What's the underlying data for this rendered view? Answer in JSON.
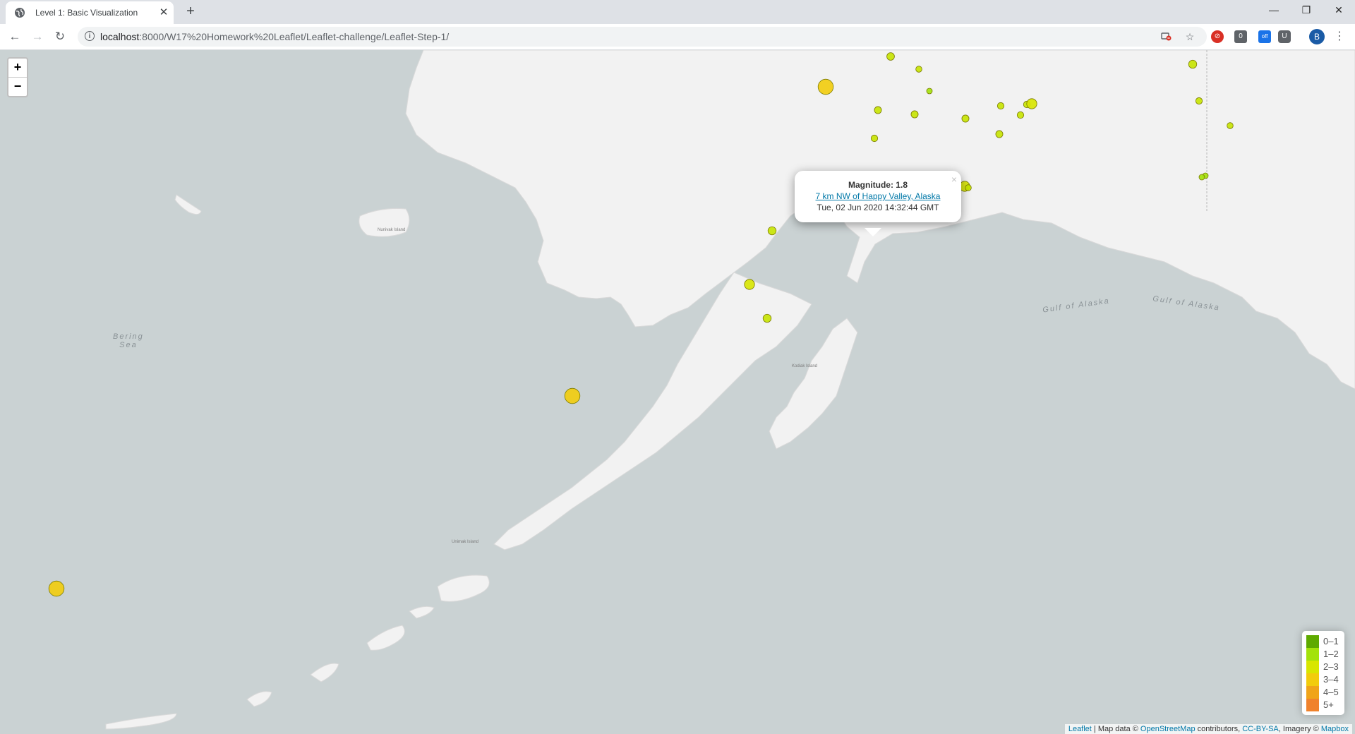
{
  "tab": {
    "title": "Level 1: Basic Visualization",
    "close": "✕",
    "new": "+"
  },
  "window": {
    "minimize": "—",
    "maximize": "❐",
    "close": "✕"
  },
  "nav": {
    "back": "←",
    "forward": "→",
    "reload": "↻"
  },
  "address": {
    "host": "localhost",
    "path": ":8000/W17%20Homework%20Leaflet/Leaflet-challenge/Leaflet-Step-1/"
  },
  "profile": {
    "initial": "B"
  },
  "zoom": {
    "in": "+",
    "out": "−"
  },
  "popup": {
    "magnitude_label": "Magnitude: 1.8",
    "place": "7 km NW of Happy Valley, Alaska",
    "time": "Tue, 02 Jun 2020 14:32:44 GMT",
    "close": "×"
  },
  "map_labels": {
    "bering_sea": "Bering\nSea",
    "gulf_of_alaska_1": "Gulf of Alaska",
    "gulf_of_alaska_2": "Gulf of Alaska",
    "nunivak": "Nunivak Island",
    "unimak": "Unimak Island",
    "kodiak": "Kodiak Island"
  },
  "legend": [
    {
      "label": "0–1",
      "color": "#5eaa00"
    },
    {
      "label": "1–2",
      "color": "#a3e20a"
    },
    {
      "label": "2–3",
      "color": "#d8e600"
    },
    {
      "label": "3–4",
      "color": "#f2cc0c"
    },
    {
      "label": "4–5",
      "color": "#f0a419"
    },
    {
      "label": "5+",
      "color": "#f0822c"
    }
  ],
  "attribution": {
    "leaflet": "Leaflet",
    "sep1": " | Map data © ",
    "osm": "OpenStreetMap",
    "contributors": " contributors, ",
    "license": "CC-BY-SA",
    "imagery": ", Imagery © ",
    "mapbox": "Mapbox"
  },
  "earthquakes": [
    {
      "mag": 3.0,
      "color": "#f2cc0c"
    },
    {
      "mag": 1.5,
      "color": "#c6e400"
    },
    {
      "mag": 1.2,
      "color": "#c6e400"
    },
    {
      "mag": 1.0,
      "color": "#a3e20a"
    },
    {
      "mag": 1.4,
      "color": "#c6e400"
    },
    {
      "mag": 1.4,
      "color": "#c6e400"
    },
    {
      "mag": 1.4,
      "color": "#c6e400"
    },
    {
      "mag": 1.3,
      "color": "#c6e400"
    },
    {
      "mag": 1.3,
      "color": "#c6e400"
    },
    {
      "mag": 1.3,
      "color": "#c6e400"
    },
    {
      "mag": 2.0,
      "color": "#d8e600"
    },
    {
      "mag": 1.4,
      "color": "#c6e400"
    },
    {
      "mag": 1.3,
      "color": "#c6e400"
    },
    {
      "mag": 1.6,
      "color": "#c6e400"
    },
    {
      "mag": 1.2,
      "color": "#c6e400"
    },
    {
      "mag": 1.3,
      "color": "#c6e400"
    },
    {
      "mag": 1.2,
      "color": "#a3e20a"
    },
    {
      "mag": 1.5,
      "color": "#c6e400"
    },
    {
      "mag": 2.0,
      "color": "#d8e600"
    },
    {
      "mag": 1.2,
      "color": "#c6e400"
    },
    {
      "mag": 1.0,
      "color": "#a3e20a"
    },
    {
      "mag": 1.0,
      "color": "#a3e20a"
    },
    {
      "mag": 1.6,
      "color": "#c6e400"
    },
    {
      "mag": 2.0,
      "color": "#d8e600"
    },
    {
      "mag": 1.6,
      "color": "#c6e400"
    },
    {
      "mag": 3.0,
      "color": "#f2cc0c"
    },
    {
      "mag": 3.0,
      "color": "#f2cc0c"
    },
    {
      "mag": 1.8,
      "color": "#a3e20a"
    }
  ]
}
